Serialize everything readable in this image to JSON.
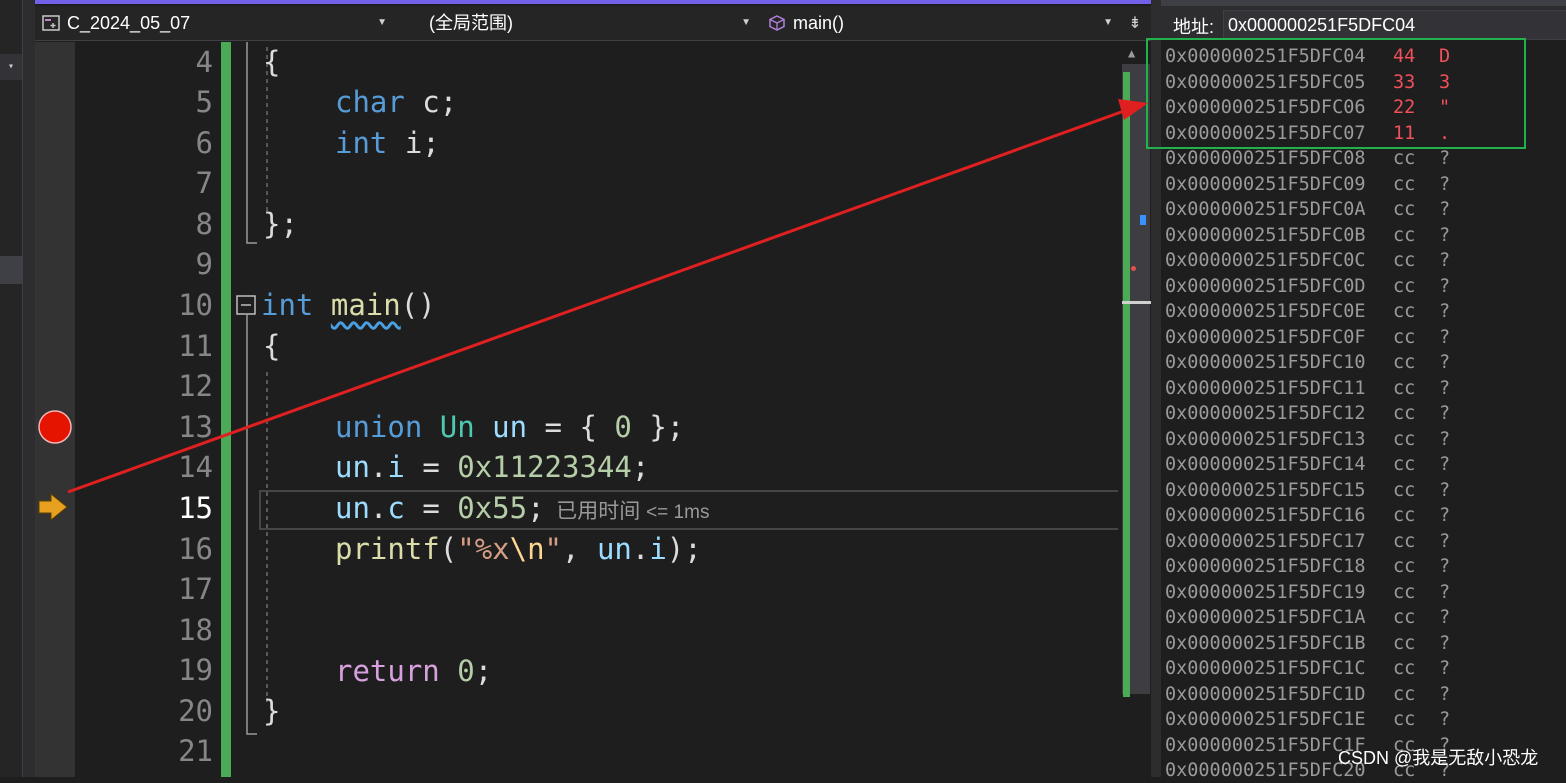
{
  "nav": {
    "project": "C_2024_05_07",
    "scope": "(全局范围)",
    "member": "main()"
  },
  "editor": {
    "line_numbers": [
      "4",
      "5",
      "6",
      "7",
      "8",
      "9",
      "10",
      "11",
      "12",
      "13",
      "14",
      "15",
      "16",
      "17",
      "18",
      "19",
      "20",
      "21"
    ],
    "current_line": "15",
    "breakpoint_line": "13",
    "elapsed_label": "已用时间",
    "elapsed_value": "<= 1ms",
    "code": {
      "l4_brace": "{",
      "l5_kw": "char",
      "l5_rest": " c;",
      "l6_kw": "int",
      "l6_rest": " i;",
      "l8_close": "};",
      "l10_kw": "int",
      "l10_fn": "main",
      "l10_rest": "()",
      "l11_brace": "{",
      "l13_kw": "union",
      "l13_type": "Un",
      "l13_var": "un",
      "l13_rest1": " = { ",
      "l13_num": "0",
      "l13_rest2": " };",
      "l14_var": "un",
      "l14_dot": ".",
      "l14_mem": "i",
      "l14_eq": " = ",
      "l14_num": "0x11223344",
      "l14_end": ";",
      "l15_var": "un",
      "l15_dot": ".",
      "l15_mem": "c",
      "l15_eq": " = ",
      "l15_num": "0x55",
      "l15_end": ";",
      "l16_fn": "printf",
      "l16_p1": "(",
      "l16_str1": "\"%x",
      "l16_esc": "\\n",
      "l16_str2": "\"",
      "l16_comma": ", ",
      "l16_var": "un",
      "l16_dot": ".",
      "l16_mem": "i",
      "l16_end": ");",
      "l19_kw": "return",
      "l19_num": " 0",
      "l19_end": ";",
      "l20_brace": "}"
    }
  },
  "memory": {
    "address_label": "地址:",
    "address_value": "0x000000251F5DFC04",
    "rows": [
      {
        "addr": "0x000000251F5DFC04",
        "val": "44",
        "ch": "D",
        "changed": true
      },
      {
        "addr": "0x000000251F5DFC05",
        "val": "33",
        "ch": "3",
        "changed": true
      },
      {
        "addr": "0x000000251F5DFC06",
        "val": "22",
        "ch": "\"",
        "changed": true
      },
      {
        "addr": "0x000000251F5DFC07",
        "val": "11",
        "ch": ".",
        "changed": true
      },
      {
        "addr": "0x000000251F5DFC08",
        "val": "cc",
        "ch": "?",
        "changed": false
      },
      {
        "addr": "0x000000251F5DFC09",
        "val": "cc",
        "ch": "?",
        "changed": false
      },
      {
        "addr": "0x000000251F5DFC0A",
        "val": "cc",
        "ch": "?",
        "changed": false
      },
      {
        "addr": "0x000000251F5DFC0B",
        "val": "cc",
        "ch": "?",
        "changed": false
      },
      {
        "addr": "0x000000251F5DFC0C",
        "val": "cc",
        "ch": "?",
        "changed": false
      },
      {
        "addr": "0x000000251F5DFC0D",
        "val": "cc",
        "ch": "?",
        "changed": false
      },
      {
        "addr": "0x000000251F5DFC0E",
        "val": "cc",
        "ch": "?",
        "changed": false
      },
      {
        "addr": "0x000000251F5DFC0F",
        "val": "cc",
        "ch": "?",
        "changed": false
      },
      {
        "addr": "0x000000251F5DFC10",
        "val": "cc",
        "ch": "?",
        "changed": false
      },
      {
        "addr": "0x000000251F5DFC11",
        "val": "cc",
        "ch": "?",
        "changed": false
      },
      {
        "addr": "0x000000251F5DFC12",
        "val": "cc",
        "ch": "?",
        "changed": false
      },
      {
        "addr": "0x000000251F5DFC13",
        "val": "cc",
        "ch": "?",
        "changed": false
      },
      {
        "addr": "0x000000251F5DFC14",
        "val": "cc",
        "ch": "?",
        "changed": false
      },
      {
        "addr": "0x000000251F5DFC15",
        "val": "cc",
        "ch": "?",
        "changed": false
      },
      {
        "addr": "0x000000251F5DFC16",
        "val": "cc",
        "ch": "?",
        "changed": false
      },
      {
        "addr": "0x000000251F5DFC17",
        "val": "cc",
        "ch": "?",
        "changed": false
      },
      {
        "addr": "0x000000251F5DFC18",
        "val": "cc",
        "ch": "?",
        "changed": false
      },
      {
        "addr": "0x000000251F5DFC19",
        "val": "cc",
        "ch": "?",
        "changed": false
      },
      {
        "addr": "0x000000251F5DFC1A",
        "val": "cc",
        "ch": "?",
        "changed": false
      },
      {
        "addr": "0x000000251F5DFC1B",
        "val": "cc",
        "ch": "?",
        "changed": false
      },
      {
        "addr": "0x000000251F5DFC1C",
        "val": "cc",
        "ch": "?",
        "changed": false
      },
      {
        "addr": "0x000000251F5DFC1D",
        "val": "cc",
        "ch": "?",
        "changed": false
      },
      {
        "addr": "0x000000251F5DFC1E",
        "val": "cc",
        "ch": "?",
        "changed": false
      },
      {
        "addr": "0x000000251F5DFC1F",
        "val": "cc",
        "ch": "?",
        "changed": false
      },
      {
        "addr": "0x000000251F5DFC20",
        "val": "cc",
        "ch": "?",
        "changed": false
      }
    ]
  },
  "watermark": "CSDN @我是无敌小恐龙",
  "colors": {
    "accent": "#7160e8",
    "change_bar": "#4caa57",
    "changed_value": "#f0505a",
    "highlight_box": "#22b14c",
    "arrow": "#e02020",
    "breakpoint": "#e51400",
    "current_arrow": "#e8a020"
  },
  "icons": {
    "project": "project-icon",
    "member": "cube-icon",
    "breakpoint": "breakpoint-icon",
    "execution": "current-statement-arrow-icon"
  }
}
